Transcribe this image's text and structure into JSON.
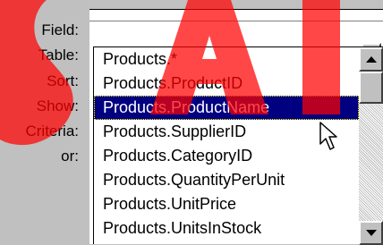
{
  "grid": {
    "row_labels": [
      "Field:",
      "Table:",
      "Sort:",
      "Show:",
      "Criteria:",
      "or:"
    ]
  },
  "dropdown": {
    "items": [
      "Products.*",
      "Products.ProductID",
      "Products.ProductName",
      "Products.SupplierID",
      "Products.CategoryID",
      "Products.QuantityPerUnit",
      "Products.UnitPrice",
      "Products.UnitsInStock"
    ],
    "selected_index": 2
  },
  "icons": {
    "combo": "chevron-down-icon",
    "scroll_up": "triangle-up-icon",
    "scroll_down": "triangle-down-icon",
    "cursor": "arrow-cursor-icon"
  },
  "colors": {
    "selection_bg": "#000080",
    "selection_text": "#ffffff",
    "face": "#c0c0c0",
    "watermark": "#ff0000"
  }
}
